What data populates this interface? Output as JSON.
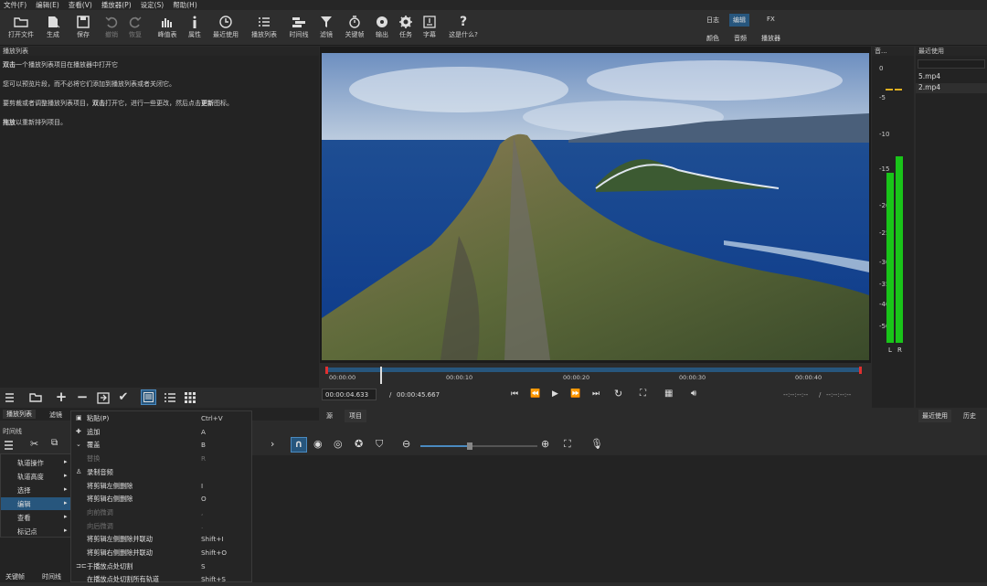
{
  "menu": [
    "文件(F)",
    "编辑(E)",
    "查看(V)",
    "播放器(P)",
    "设定(S)",
    "帮助(H)"
  ],
  "toolbar": {
    "open": "打开文件",
    "generate": "生成",
    "save": "保存",
    "undo": "撤销",
    "redo": "恢复",
    "peaks": "峰值表",
    "properties": "属性",
    "recent": "最近使用",
    "playlist": "播放列表",
    "timeline": "时间线",
    "filters": "滤镜",
    "keyframes": "关键帧",
    "export": "输出",
    "jobs": "任务",
    "subtitles": "字幕",
    "whats_this": "这是什么?"
  },
  "layouts": {
    "logging": "日志",
    "editing": "编辑",
    "fx": "FX",
    "color": "颜色",
    "audio": "音频",
    "player": "播放器"
  },
  "playlist_panel": {
    "title": "播放列表",
    "hint1_bold": "双击",
    "hint1": "一个播放列表项目在播放器中打开它",
    "hint2": "您可以预览片段，而不必将它们添加到播放列表或者关闭它。",
    "hint3_a": "要剪裁或者调整播放列表项目，",
    "hint3_bold1": "双击",
    "hint3_b": "打开它，进行一些更改，然后点击",
    "hint3_bold2": "更新",
    "hint3_c": "图标。",
    "hint4_bold": "拖放",
    "hint4": "以重新排列项目。"
  },
  "left_tabs": {
    "playlist": "播放列表",
    "filters": "滤镜"
  },
  "timeline_label": "时间线",
  "bottom_tabs": {
    "keyframes": "关键帧",
    "timeline": "时间线"
  },
  "ruler": [
    "00:00:00",
    "00:00:10",
    "00:00:20",
    "00:00:30",
    "00:00:40"
  ],
  "timecode": {
    "current": "00:00:04.633",
    "separator": "/",
    "total": "00:00:45.667",
    "in_out": "--:--:--:--",
    "in_out_sep": "/",
    "in_out2": "--:--:--:--"
  },
  "player_tabs": {
    "source": "源",
    "project": "项目"
  },
  "meter": {
    "title": "音...",
    "scale": [
      "0",
      "-5",
      "-10",
      "-15",
      "-20",
      "-25",
      "-30",
      "-35",
      "-40",
      "-50"
    ],
    "left": "L",
    "right": "R",
    "level_left": 0.62,
    "level_right": 0.68
  },
  "recent_panel": {
    "title": "最近使用",
    "items": [
      "5.mp4",
      "2.mp4"
    ],
    "tab_recent": "最近使用",
    "tab_history": "历史"
  },
  "submenu": {
    "items": [
      "轨道操作",
      "轨道高度",
      "选择",
      "编辑",
      "查看",
      "标记点"
    ],
    "selected": 3
  },
  "context_menu": [
    {
      "icon": "paste-icon",
      "label": "粘贴(P)",
      "key": "Ctrl+V",
      "disabled": false
    },
    {
      "icon": "plus-icon",
      "label": "追加",
      "key": "A",
      "disabled": false
    },
    {
      "icon": "chevron-down-icon",
      "label": "覆盖",
      "key": "B",
      "disabled": false
    },
    {
      "icon": "",
      "label": "替换",
      "key": "R",
      "disabled": true
    },
    {
      "icon": "mic-icon",
      "label": "录制音频",
      "key": "",
      "disabled": false
    },
    {
      "icon": "",
      "label": "将剪辑左侧删除",
      "key": "I",
      "disabled": false
    },
    {
      "icon": "",
      "label": "将剪辑右侧删除",
      "key": "O",
      "disabled": false
    },
    {
      "icon": "",
      "label": "向前微调",
      "key": ",",
      "disabled": true
    },
    {
      "icon": "",
      "label": "向后微调",
      "key": ".",
      "disabled": true
    },
    {
      "icon": "",
      "label": "将剪辑左侧删除并联动",
      "key": "Shift+I",
      "disabled": false
    },
    {
      "icon": "",
      "label": "将剪辑右侧删除并联动",
      "key": "Shift+O",
      "disabled": false
    },
    {
      "icon": "split-icon",
      "label": "于播放点处切割",
      "key": "S",
      "disabled": false
    },
    {
      "icon": "",
      "label": "在播放点处切割所有轨道",
      "key": "Shift+S",
      "disabled": false
    }
  ],
  "zoom_slider": 0.42,
  "playhead_position": 0.1,
  "colors": {
    "accent": "#27567d",
    "meter_green": "#19c419",
    "playhead_red": "#e03030"
  }
}
